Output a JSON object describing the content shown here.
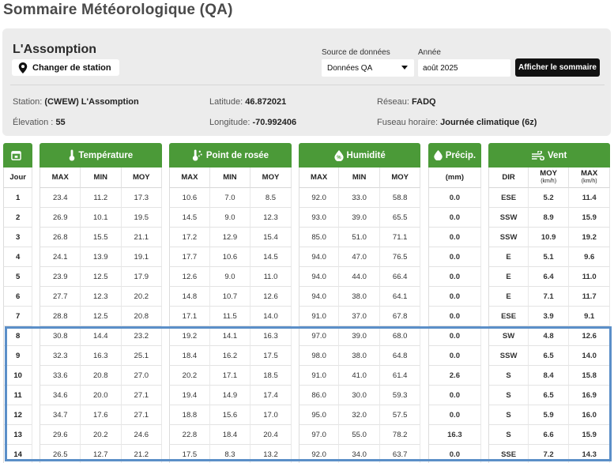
{
  "page": {
    "title": "Sommaire Météorologique (QA)"
  },
  "station": {
    "name": "L'Assomption",
    "change_label": "Changer de station"
  },
  "controls": {
    "source_label": "Source de données",
    "source_value": "Données QA",
    "year_label": "Année",
    "year_value": "août 2025",
    "summary_button": "Afficher le sommaire"
  },
  "info": {
    "station_label": "Station:",
    "station_value": "(CWEW) L'Assomption",
    "elevation_label": "Élevation :",
    "elevation_value": "55",
    "latitude_label": "Latitude:",
    "latitude_value": "46.872021",
    "longitude_label": "Longitude:",
    "longitude_value": "-70.992406",
    "network_label": "Réseau:",
    "network_value": "FADQ",
    "timezone_label": "Fuseau horaire:",
    "timezone_value": "Journée climatique (6z)"
  },
  "groups": {
    "temperature": "Température",
    "dew": "Point de rosée",
    "humidity": "Humidité",
    "precip": "Précip.",
    "wind": "Vent"
  },
  "subheaders": {
    "day": "Jour",
    "max": "MAX",
    "min": "MIN",
    "moy": "MOY",
    "mm": "(mm)",
    "dir": "DIR",
    "unit": "(km/h)"
  },
  "rows": [
    [
      "1",
      "23.4",
      "11.2",
      "17.3",
      "10.6",
      "7.0",
      "8.5",
      "92.0",
      "33.0",
      "58.8",
      "0.0",
      "ESE",
      "5.2",
      "11.4"
    ],
    [
      "2",
      "26.9",
      "10.1",
      "19.5",
      "14.5",
      "9.0",
      "12.3",
      "93.0",
      "39.0",
      "65.5",
      "0.0",
      "SSW",
      "8.9",
      "15.9"
    ],
    [
      "3",
      "26.8",
      "15.5",
      "21.1",
      "17.2",
      "12.9",
      "15.4",
      "85.0",
      "51.0",
      "71.1",
      "0.0",
      "SSW",
      "10.9",
      "19.2"
    ],
    [
      "4",
      "24.1",
      "13.9",
      "19.1",
      "17.7",
      "10.6",
      "14.5",
      "94.0",
      "47.0",
      "76.5",
      "0.0",
      "E",
      "5.1",
      "9.6"
    ],
    [
      "5",
      "23.9",
      "12.5",
      "17.9",
      "12.6",
      "9.0",
      "11.0",
      "94.0",
      "44.0",
      "66.4",
      "0.0",
      "E",
      "6.4",
      "11.0"
    ],
    [
      "6",
      "27.7",
      "12.3",
      "20.2",
      "14.8",
      "10.7",
      "12.6",
      "94.0",
      "38.0",
      "64.1",
      "0.0",
      "E",
      "7.1",
      "11.7"
    ],
    [
      "7",
      "28.8",
      "12.5",
      "20.8",
      "17.1",
      "11.5",
      "14.0",
      "91.0",
      "37.0",
      "67.8",
      "0.0",
      "ESE",
      "3.9",
      "9.1"
    ],
    [
      "8",
      "30.8",
      "14.4",
      "23.2",
      "19.2",
      "14.1",
      "16.3",
      "97.0",
      "39.0",
      "68.0",
      "0.0",
      "SW",
      "4.8",
      "12.6"
    ],
    [
      "9",
      "32.3",
      "16.3",
      "25.1",
      "18.4",
      "16.2",
      "17.5",
      "98.0",
      "38.0",
      "64.8",
      "0.0",
      "SSW",
      "6.5",
      "14.0"
    ],
    [
      "10",
      "33.6",
      "20.8",
      "27.0",
      "20.2",
      "17.1",
      "18.5",
      "91.0",
      "41.0",
      "61.4",
      "2.6",
      "S",
      "8.4",
      "15.8"
    ],
    [
      "11",
      "34.6",
      "20.0",
      "27.1",
      "19.4",
      "14.9",
      "17.4",
      "86.0",
      "30.0",
      "59.3",
      "0.0",
      "S",
      "6.5",
      "16.9"
    ],
    [
      "12",
      "34.7",
      "17.6",
      "27.1",
      "18.8",
      "15.6",
      "17.0",
      "95.0",
      "32.0",
      "57.5",
      "0.0",
      "S",
      "5.9",
      "16.0"
    ],
    [
      "13",
      "29.6",
      "20.2",
      "24.6",
      "22.8",
      "18.4",
      "20.4",
      "97.0",
      "55.0",
      "78.2",
      "16.3",
      "S",
      "6.6",
      "15.9"
    ],
    [
      "14",
      "26.5",
      "12.7",
      "21.2",
      "17.5",
      "8.3",
      "13.2",
      "92.0",
      "34.0",
      "63.7",
      "0.0",
      "SSE",
      "7.2",
      "14.3"
    ]
  ],
  "colors": {
    "accent": "#4b9a38",
    "highlight": "#5b8fc8",
    "panel": "#ececec"
  }
}
